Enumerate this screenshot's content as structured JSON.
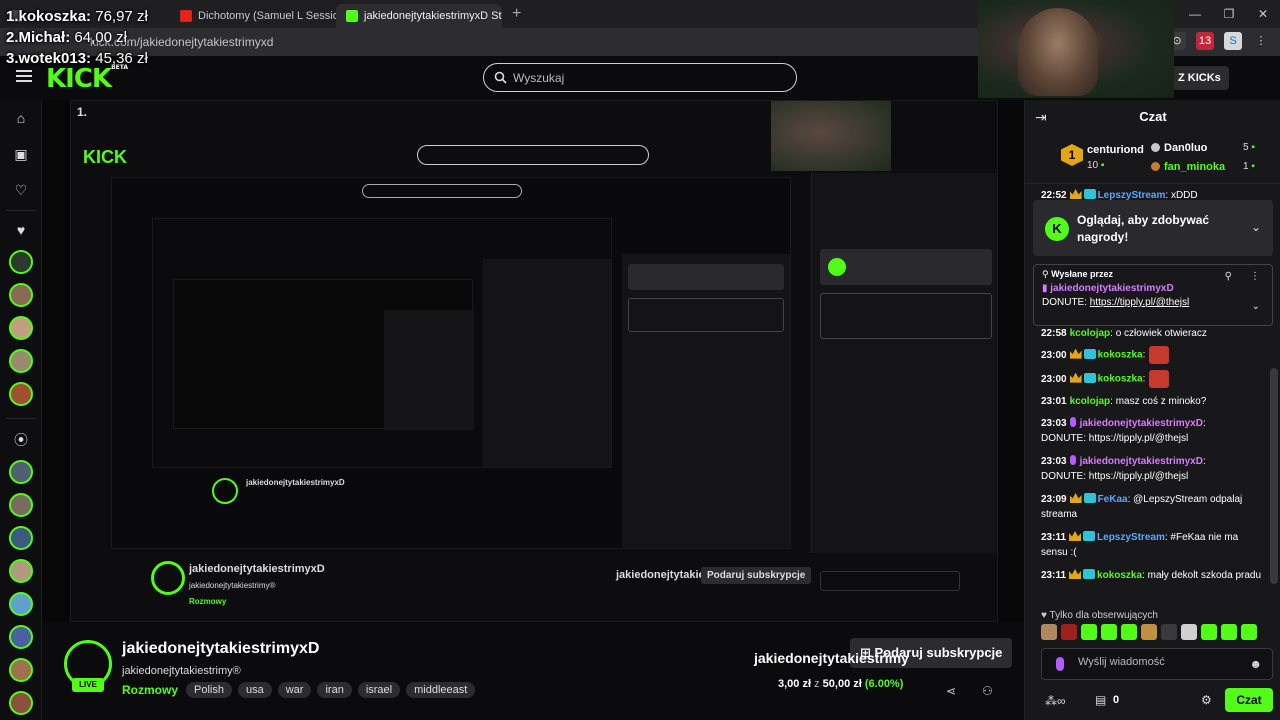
{
  "browser": {
    "tabs": [
      {
        "label": "",
        "fav": "#444"
      },
      {
        "label": "Dichotomy (Samuel L Session M",
        "fav": "#e62117"
      },
      {
        "label": "jakiedonejtytakiestrimyxD Stre",
        "fav": "#53fc18"
      }
    ],
    "url": "kick.com/jakiedonejtytakiestrimyxd",
    "ext_badge": "13"
  },
  "donors": [
    {
      "rank": "1.",
      "name": "kokoszka:",
      "amount": "76,97 zł"
    },
    {
      "rank": "2.",
      "name": "Michał:",
      "amount": "64,00 zł"
    },
    {
      "rank": "3.",
      "name": "wotek013:",
      "amount": "45,36 zł"
    }
  ],
  "header": {
    "logo": "KICK",
    "logo_tag": "BETA",
    "search_placeholder": "Wyszukaj",
    "kicks_label": "Z KICKs"
  },
  "channel": {
    "name": "jakiedonejtytakiestrimyxD",
    "handle": "jakiedonejtytakiestrimy®",
    "live": "LIVE",
    "category": "Rozmowy",
    "tags": [
      "Polish",
      "usa",
      "war",
      "iran",
      "israel",
      "middleeast"
    ],
    "subscribe": "Podaruj subskrypcje",
    "goal_name": "jakiedonejtytakiestrimy",
    "goal_current": "3,00 zł",
    "goal_sep": "z",
    "goal_target": "50,00 zł",
    "goal_pct": "(6.00%)"
  },
  "chat": {
    "title": "Czat",
    "leaderboard": {
      "first": {
        "rank": "1",
        "name": "centuriond",
        "value": "10"
      },
      "second": {
        "name": "Dan0luo",
        "value": "5"
      },
      "third": {
        "name": "fan_minoka",
        "value": "1"
      }
    },
    "promo": "Oglądaj, aby zdobywać nagrody!",
    "pinned": {
      "by": "Wysłane przez",
      "user": "jakiedonejtytakiestrimyxD",
      "prefix": "DONUTE:",
      "link": "https://tipply.pl/@thejsl"
    },
    "messages": [
      {
        "time": "22:52",
        "user": "LepszyStream",
        "color": "#57a8ff",
        "text": "xDDD",
        "badges": [
          "crown",
          "sub"
        ],
        "emote": false
      },
      {
        "time": "22:58",
        "user": "kcolojap",
        "color": "#53fc18",
        "text": "o człowiek otwieracz",
        "badges": [],
        "emote": false
      },
      {
        "time": "23:00",
        "user": "kokoszka",
        "color": "#53fc18",
        "text": "",
        "badges": [
          "crown",
          "sub"
        ],
        "emote": true
      },
      {
        "time": "23:00",
        "user": "kokoszka",
        "color": "#53fc18",
        "text": "",
        "badges": [
          "crown",
          "sub"
        ],
        "emote": true
      },
      {
        "time": "23:01",
        "user": "kcolojap",
        "color": "#53fc18",
        "text": "masz coś z minoko?",
        "badges": [],
        "emote": false
      },
      {
        "time": "23:03",
        "user": "jakiedonejtytakiestrimyxD",
        "color": "#d77cff",
        "text": "DONUTE: https://tipply.pl/@thejsl",
        "badges": [
          "mic"
        ],
        "emote": false
      },
      {
        "time": "23:03",
        "user": "jakiedonejtytakiestrimyxD",
        "color": "#d77cff",
        "text": "DONUTE: https://tipply.pl/@thejsl",
        "badges": [
          "mic"
        ],
        "emote": false
      },
      {
        "time": "23:09",
        "user": "FeKaa",
        "color": "#57a8ff",
        "text": "@LepszyStream odpalaj streama",
        "badges": [
          "crown",
          "sub"
        ],
        "emote": false
      },
      {
        "time": "23:11",
        "user": "LepszyStream",
        "color": "#57a8ff",
        "text": "#FeKaa nie ma sensu :(",
        "badges": [
          "crown",
          "sub"
        ],
        "emote": false
      },
      {
        "time": "23:11",
        "user": "kokoszka",
        "color": "#53fc18",
        "text": "mały dekolt szkoda pradu",
        "badges": [
          "crown",
          "sub"
        ],
        "emote": false
      }
    ],
    "followers_only": "Tylko dla obserwujących",
    "input_placeholder": "Wyślij wiadomość",
    "gift_count": "0",
    "send": "Czat"
  },
  "colors": {
    "accent": "#53fc18",
    "chat_bg": "#18181b",
    "page_bg": "#0b0b0d"
  }
}
